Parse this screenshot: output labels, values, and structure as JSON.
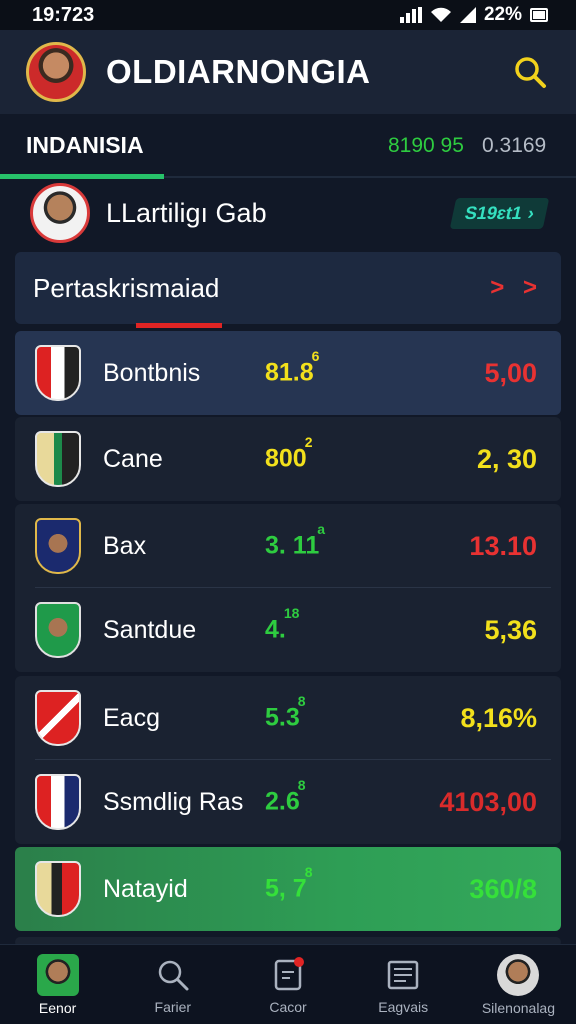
{
  "status_bar": {
    "time": "19:723",
    "battery": "22%"
  },
  "header": {
    "title": "OLDIARNONGIA",
    "search_icon": "search-icon"
  },
  "tab": {
    "label": "INDANISIA",
    "value_green": "8190 95",
    "value_gray": "0.3169"
  },
  "profile": {
    "name": "LLartiligı Gab",
    "badge": "S19ɛt1"
  },
  "section": {
    "title": "Pertaskrismaiad",
    "arrow": "> >"
  },
  "colors": {
    "green": "#2ecc40",
    "yellow": "#f2e01c",
    "red": "#e83232",
    "accent_blue": "#263552",
    "highlight_green": "#2e9e55"
  },
  "rows": [
    {
      "name": "Bontbnis",
      "odd": "81.8",
      "odd_sup": "6",
      "odd_color": "#f2e01c",
      "price": "5,00",
      "price_color": "#e83232"
    },
    {
      "name": "Cane",
      "odd": "800",
      "odd_sup": "2",
      "odd_color": "#f2e01c",
      "price": "2, 30",
      "price_color": "#f2e01c"
    },
    {
      "name": "Bax",
      "odd": "3. 11",
      "odd_sup": "a",
      "odd_color": "#2ecc40",
      "price": "13.10",
      "price_color": "#e83232"
    },
    {
      "name": "Santdue",
      "odd": "4.",
      "odd_sup": "18",
      "odd_color": "#2ecc40",
      "price": "5,36",
      "price_color": "#f2e01c"
    },
    {
      "name": "Eacg",
      "odd": "5.3",
      "odd_sup": "8",
      "odd_color": "#2ecc40",
      "price": "8,16%",
      "price_color": "#f2e01c"
    },
    {
      "name": "Ssmdlig Ras",
      "odd": "2.6",
      "odd_sup": "8",
      "odd_color": "#2ecc40",
      "price": "4103,00",
      "price_color": "#d92b2b"
    },
    {
      "name": "Natayid",
      "odd": "5, 7",
      "odd_sup": "8",
      "odd_color": "#35e03a",
      "price": "360/8",
      "price_color": "#35e03a"
    }
  ],
  "nav": [
    {
      "label": "Eenor"
    },
    {
      "label": "Farier"
    },
    {
      "label": "Cacor"
    },
    {
      "label": "Eagvais"
    },
    {
      "label": "Silenonalag"
    }
  ]
}
